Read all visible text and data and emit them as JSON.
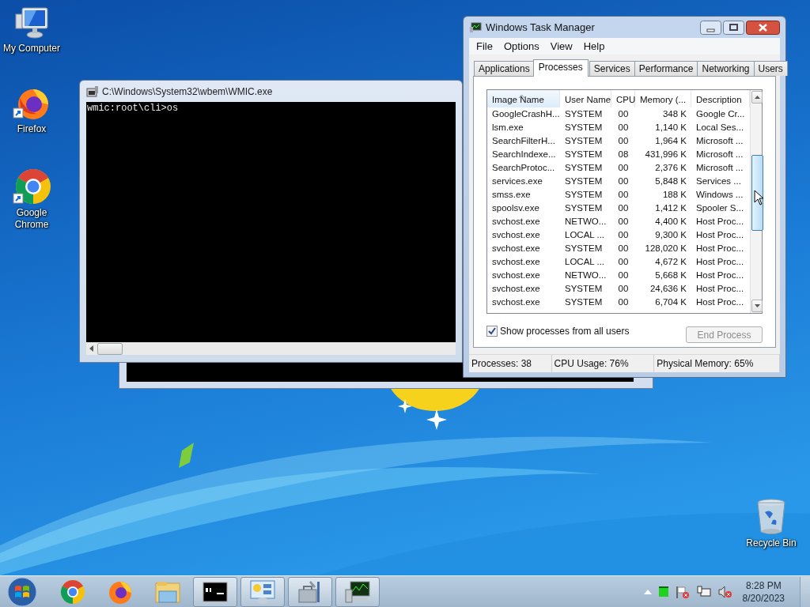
{
  "desktop_icons": [
    {
      "label": "My Computer",
      "kind": "computer"
    },
    {
      "label": "Firefox",
      "kind": "firefox"
    },
    {
      "label": "Google Chrome",
      "kind": "chrome"
    },
    {
      "label": "Recycle Bin",
      "kind": "recycle"
    }
  ],
  "console": {
    "title": "C:\\Windows\\System32\\wbem\\WMIC.exe",
    "lines": [
      "wmic:root\\cli>os"
    ]
  },
  "task_manager": {
    "title": "Windows Task Manager",
    "menu": [
      "File",
      "Options",
      "View",
      "Help"
    ],
    "tabs": [
      {
        "label": "Applications",
        "selected": false
      },
      {
        "label": "Processes",
        "selected": true
      },
      {
        "label": "Services",
        "selected": false
      },
      {
        "label": "Performance",
        "selected": false
      },
      {
        "label": "Networking",
        "selected": false
      },
      {
        "label": "Users",
        "selected": false
      }
    ],
    "columns": [
      {
        "label": "Image Name",
        "sorted": true
      },
      {
        "label": "User Name",
        "sorted": false
      },
      {
        "label": "CPU",
        "sorted": false
      },
      {
        "label": "Memory (...",
        "sorted": false
      },
      {
        "label": "Description",
        "sorted": false
      }
    ],
    "rows": [
      [
        "GoogleCrashH...",
        "SYSTEM",
        "00",
        "348 K",
        "Google Cr..."
      ],
      [
        "lsm.exe",
        "SYSTEM",
        "00",
        "1,140 K",
        "Local Ses..."
      ],
      [
        "SearchFilterH...",
        "SYSTEM",
        "00",
        "1,964 K",
        "Microsoft ..."
      ],
      [
        "SearchIndexe...",
        "SYSTEM",
        "08",
        "431,996 K",
        "Microsoft ..."
      ],
      [
        "SearchProtoc...",
        "SYSTEM",
        "00",
        "2,376 K",
        "Microsoft ..."
      ],
      [
        "services.exe",
        "SYSTEM",
        "00",
        "5,848 K",
        "Services ..."
      ],
      [
        "smss.exe",
        "SYSTEM",
        "00",
        "188 K",
        "Windows ..."
      ],
      [
        "spoolsv.exe",
        "SYSTEM",
        "00",
        "1,412 K",
        "Spooler S..."
      ],
      [
        "svchost.exe",
        "NETWO...",
        "00",
        "4,400 K",
        "Host Proc..."
      ],
      [
        "svchost.exe",
        "LOCAL ...",
        "00",
        "9,300 K",
        "Host Proc..."
      ],
      [
        "svchost.exe",
        "SYSTEM",
        "00",
        "128,020 K",
        "Host Proc..."
      ],
      [
        "svchost.exe",
        "LOCAL ...",
        "00",
        "4,672 K",
        "Host Proc..."
      ],
      [
        "svchost.exe",
        "NETWO...",
        "00",
        "5,668 K",
        "Host Proc..."
      ],
      [
        "svchost.exe",
        "SYSTEM",
        "00",
        "24,636 K",
        "Host Proc..."
      ],
      [
        "svchost.exe",
        "SYSTEM",
        "00",
        "6,704 K",
        "Host Proc..."
      ]
    ],
    "show_all_users": {
      "label": "Show processes from all users",
      "checked": true
    },
    "end_process": {
      "label": "End Process",
      "disabled": true
    },
    "status": [
      "Processes: 38",
      "CPU Usage: 76%",
      "Physical Memory: 65%"
    ]
  },
  "taskbar": {
    "items": [
      {
        "kind": "start",
        "running": false
      },
      {
        "kind": "chrome",
        "running": false
      },
      {
        "kind": "firefox",
        "running": false
      },
      {
        "kind": "explorer",
        "running": false
      },
      {
        "kind": "console",
        "running": true
      },
      {
        "kind": "control-panel",
        "running": true
      },
      {
        "kind": "tools",
        "running": true
      },
      {
        "kind": "task-manager",
        "running": true
      }
    ],
    "tray": {
      "time": "8:28 PM",
      "date": "8/20/2023"
    }
  }
}
